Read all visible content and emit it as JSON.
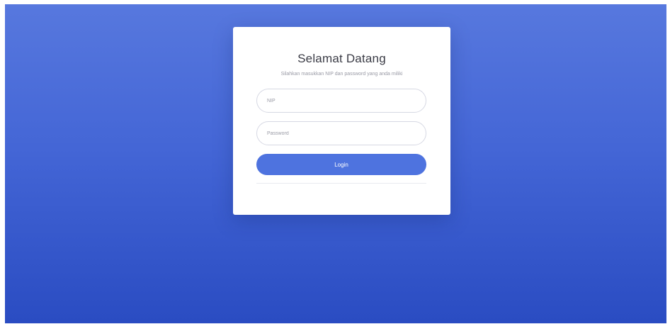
{
  "login": {
    "title": "Selamat Datang",
    "subtitle": "Silahkan masukkan NIP dan password yang anda miliki",
    "nip_placeholder": "NIP",
    "nip_value": "",
    "password_placeholder": "Password",
    "password_value": "",
    "login_label": "Login"
  },
  "colors": {
    "background_top": "#5778de",
    "background_bottom": "#2a4cc2",
    "card": "#ffffff",
    "button": "#4e73df",
    "title_text": "#3a3b45"
  }
}
